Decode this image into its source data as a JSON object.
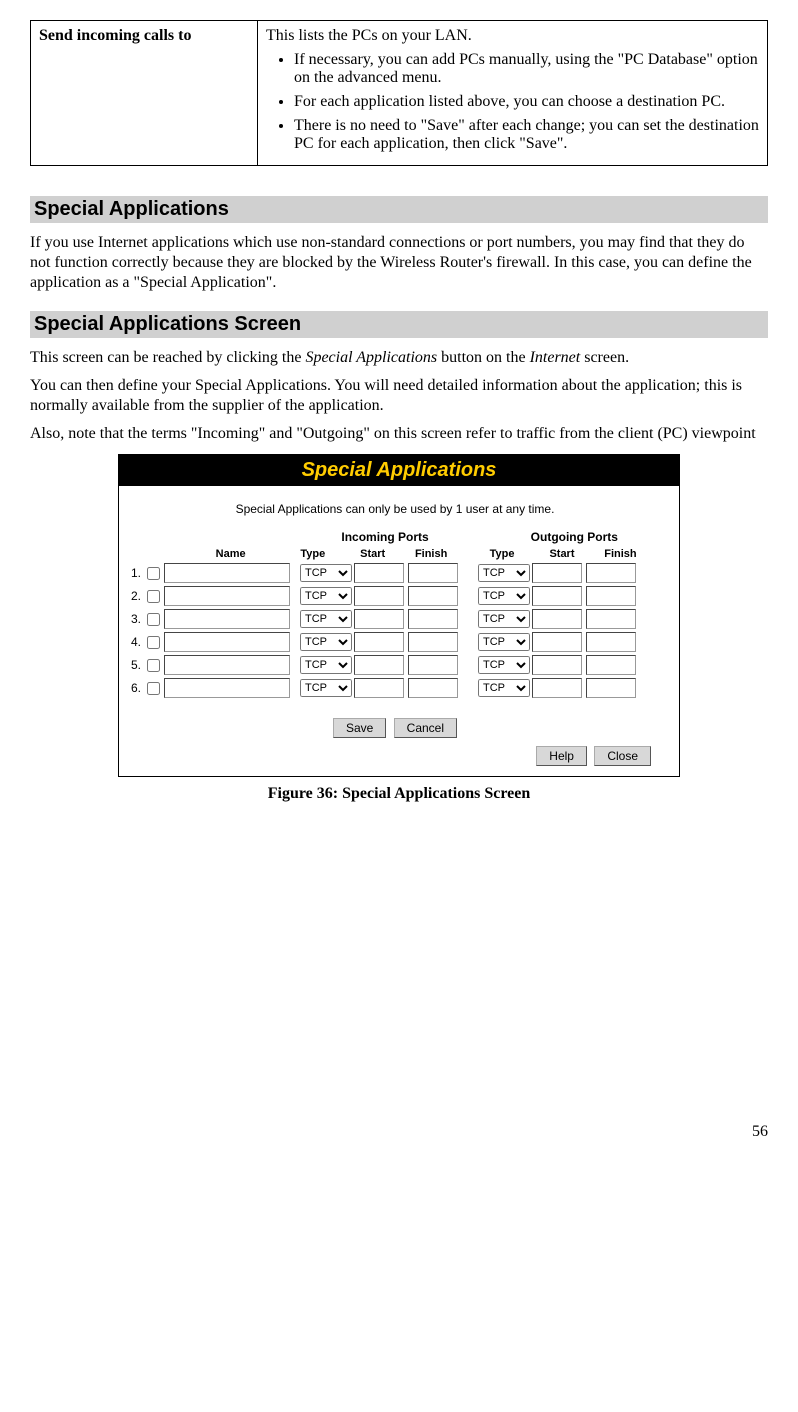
{
  "table": {
    "left_heading": "Send incoming calls to",
    "intro": "This lists the PCs on your LAN.",
    "bullets": [
      "If necessary, you can add PCs manually, using the \"PC Database\" option on the advanced menu.",
      "For each application listed above, you can choose a destination PC.",
      "There is no need to \"Save\" after each change; you can set the destination PC for each application, then click \"Save\"."
    ]
  },
  "sections": {
    "special_apps_title": "Special Applications",
    "special_apps_para": "If you use Internet applications which use non-standard connections or port numbers, you may find that they do not function correctly because they are blocked by the Wireless Router's firewall. In this case, you can define the application as a \"Special Application\".",
    "screen_title": "Special Applications Screen",
    "screen_p1_a": "This screen can be reached by clicking the ",
    "screen_p1_b": "Special Applications",
    "screen_p1_c": " button on the ",
    "screen_p1_d": "Internet",
    "screen_p1_e": " screen.",
    "screen_p2": "You can then define your Special Applications. You will need detailed information about the application; this is normally available from the supplier of the application.",
    "screen_p3": "Also, note that the terms \"Incoming\" and \"Outgoing\" on this screen refer to traffic from the client (PC) viewpoint"
  },
  "figure": {
    "banner": "Special Applications",
    "note": "Special Applications can only be used by 1 user at any time.",
    "col_name": "Name",
    "group_in": "Incoming Ports",
    "group_out": "Outgoing Ports",
    "col_type": "Type",
    "col_start": "Start",
    "col_finish": "Finish",
    "rows": [
      {
        "num": "1.",
        "type": "TCP"
      },
      {
        "num": "2.",
        "type": "TCP"
      },
      {
        "num": "3.",
        "type": "TCP"
      },
      {
        "num": "4.",
        "type": "TCP"
      },
      {
        "num": "5.",
        "type": "TCP"
      },
      {
        "num": "6.",
        "type": "TCP"
      }
    ],
    "btn_save": "Save",
    "btn_cancel": "Cancel",
    "btn_help": "Help",
    "btn_close": "Close",
    "caption": "Figure 36: Special Applications Screen"
  },
  "page_number": "56"
}
